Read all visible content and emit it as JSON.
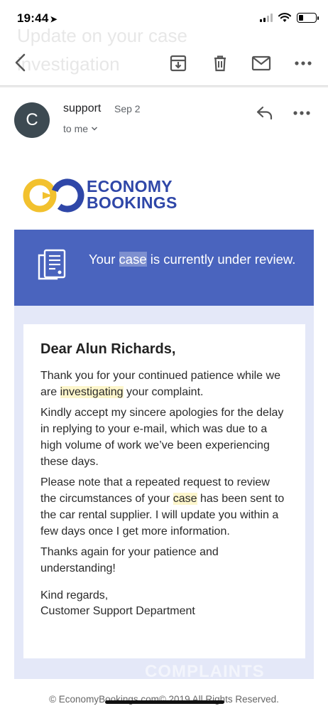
{
  "status_bar": {
    "time": "19:44",
    "location_arrow": "➤",
    "signal_bars_on": 2,
    "signal_bars_total": 4,
    "battery_level": 0.3
  },
  "email": {
    "subject": "Update on your case investigation",
    "sender_initial": "C",
    "sender": "support",
    "date": "Sep 2",
    "recipient": "to me"
  },
  "brand": {
    "logo_line1": "ECONOMY",
    "logo_line2": "BOOKINGS",
    "colors": {
      "navy": "#2f47a8",
      "yellow": "#f2c12e",
      "banner": "#4a64be"
    }
  },
  "banner": {
    "text_before": "Your ",
    "text_highlight": "case",
    "text_after": " is currently under review."
  },
  "body": {
    "greeting": "Dear Alun Richards,",
    "p1_a": "Thank you for your continued patience while we are ",
    "p1_hl": "investigating",
    "p1_b": " your complaint.",
    "p2": "Kindly accept my sincere apologies for the delay in replying to your e-mail, which was due to a high volume of work we’ve been experiencing these days.",
    "p3_a": "Please note that a repeated request to review the circumstances of your ",
    "p3_hl": "case",
    "p3_b": " has been sent to the car rental supplier. I will update you within a few days once I get more information.",
    "p4": "Thanks again for your patience and understanding!",
    "closing_1": "Kind regards,",
    "closing_2": "Customer Support Department"
  },
  "watermark": "COMPLAINTS",
  "footer": "© EconomyBookings.com© 2019 All Rights Reserved."
}
